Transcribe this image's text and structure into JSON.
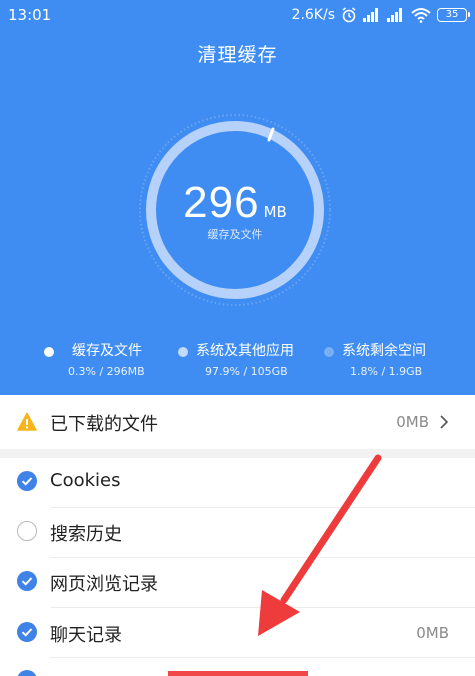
{
  "status_bar": {
    "time": "13:01",
    "speed": "2.6K/s",
    "battery": "35",
    "icons": [
      "alarm-icon",
      "signal-icon",
      "signal-icon",
      "wifi-icon",
      "battery-icon"
    ]
  },
  "header": {
    "title": "清理缓存"
  },
  "gauge": {
    "number": "296",
    "unit": "MB",
    "label": "缓存及文件"
  },
  "legend": [
    {
      "name": "缓存及文件",
      "value": "0.3% / 296MB",
      "color": "#ffffff"
    },
    {
      "name": "系统及其他应用",
      "value": "97.9% / 105GB",
      "color": "#c4dafb"
    },
    {
      "name": "系统剩余空间",
      "value": "1.8% / 1.9GB",
      "color": "#7aaef5"
    }
  ],
  "downloaded": {
    "label": "已下载的文件",
    "value": "0MB",
    "icon": "warning-icon"
  },
  "items": [
    {
      "label": "Cookies",
      "checked": true,
      "value": ""
    },
    {
      "label": "搜索历史",
      "checked": false,
      "value": ""
    },
    {
      "label": "网页浏览记录",
      "checked": true,
      "value": ""
    },
    {
      "label": "聊天记录",
      "checked": true,
      "value": "0MB"
    }
  ],
  "colors": {
    "header_bg": "#3f8df2",
    "check_on": "#3f82e8",
    "arrow": "#ee3b3b",
    "warning": "#f5b51b"
  }
}
